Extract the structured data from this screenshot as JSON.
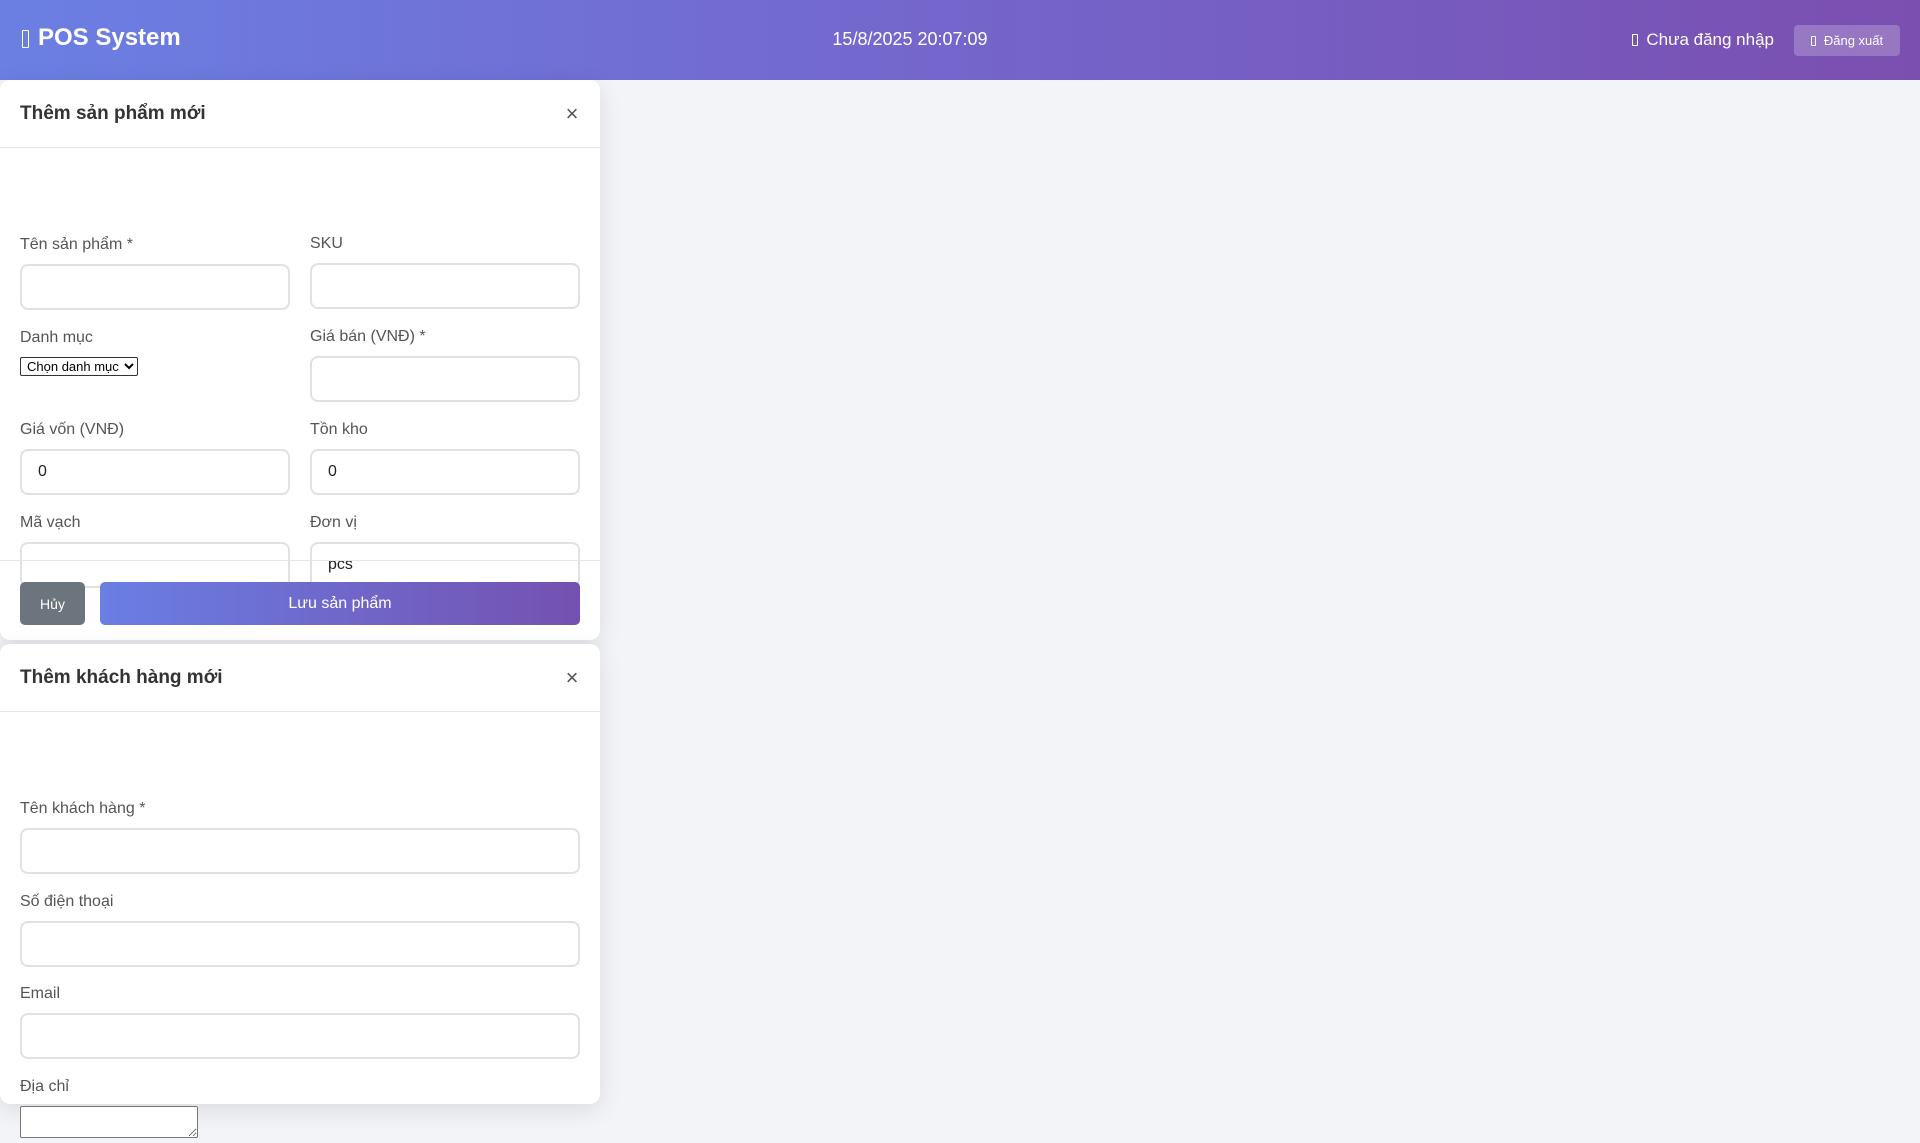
{
  "header": {
    "brand": "POS System",
    "brand_icon": "mobile-icon",
    "datetime": "15/8/2025 20:07:09",
    "user_status": "Chưa đăng nhập",
    "logout_label": "Đăng xuất"
  },
  "product_modal": {
    "title": "Thêm sản phẩm mới",
    "close": "×",
    "fields": {
      "name": {
        "label": "Tên sản phẩm *",
        "value": ""
      },
      "sku": {
        "label": "SKU",
        "value": ""
      },
      "category": {
        "label": "Danh mục",
        "selected": "Chọn danh mục"
      },
      "price": {
        "label": "Giá bán (VNĐ) *",
        "value": ""
      },
      "cost": {
        "label": "Giá vốn (VNĐ)",
        "value": "0"
      },
      "stock": {
        "label": "Tồn kho",
        "value": "0"
      },
      "barcode": {
        "label": "Mã vạch",
        "value": ""
      },
      "unit": {
        "label": "Đơn vị",
        "value": "pcs"
      }
    },
    "cancel_label": "Hủy",
    "save_label": "Lưu sản phẩm"
  },
  "customer_modal": {
    "title": "Thêm khách hàng mới",
    "close": "×",
    "fields": {
      "name": {
        "label": "Tên khách hàng *",
        "value": ""
      },
      "phone": {
        "label": "Số điện thoại",
        "value": ""
      },
      "email": {
        "label": "Email",
        "value": ""
      },
      "address": {
        "label": "Địa chỉ",
        "value": ""
      }
    }
  }
}
